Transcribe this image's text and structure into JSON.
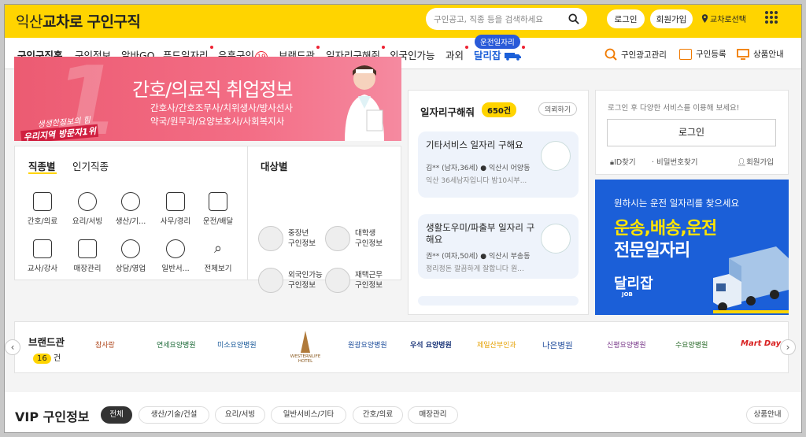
{
  "header": {
    "logo_light": "익산",
    "logo_bold": "교차로",
    "logo_suffix": "구인구직",
    "search_placeholder": "구인공고, 직종 등을 검색하세요",
    "login_label": "로그인",
    "signup_label": "회원가입",
    "region_label": "교차로선택"
  },
  "nav": {
    "items": [
      "구인구직홈",
      "구인정보",
      "알바GO",
      "푸드일자리",
      "유흥구인",
      "브랜드관",
      "일자리구해줘",
      "외국인가능",
      "과외",
      "달리잡"
    ],
    "adult_badge": "19",
    "new_bubble": "운전일자리",
    "right": [
      "구인광고관리",
      "구인등록",
      "상품안내"
    ]
  },
  "banner": {
    "title": "간호/의료직 취업정보",
    "line1": "간호사/간호조무사/치위생사/방사선사",
    "line2": "약국/원무과/요양보호사/사회복지사",
    "tag_top": "생생한정보의 힘",
    "tag_bottom": "우리지역 방문자1위"
  },
  "categories": {
    "tab_job": "직종별",
    "tab_popular": "인기직종",
    "items": [
      "간호/의료",
      "요리/서빙",
      "생산/기...",
      "사무/경리",
      "운전/배달",
      "교사/강사",
      "매장관리",
      "상담/영업",
      "일반서...",
      "전체보기"
    ],
    "target_title": "대상별",
    "targets": [
      {
        "l1": "중장년",
        "l2": "구인정보"
      },
      {
        "l1": "대학생",
        "l2": "구인정보"
      },
      {
        "l1": "외국인가능",
        "l2": "구인정보"
      },
      {
        "l1": "재택근무",
        "l2": "구인정보"
      }
    ]
  },
  "jobwant": {
    "title": "일자리구해줘",
    "count": "650건",
    "request_label": "의뢰하기",
    "posts": [
      {
        "title": "기타서비스 일자리 구해요",
        "name": "김** (남자,36세)",
        "location": "익산시 어양동",
        "desc": "익산 36세남자입니다 밤10시부..."
      },
      {
        "title": "생활도우미/파출부 일자리 구해요",
        "name": "권** (여자,50세)",
        "location": "익산시 부송동",
        "desc": "정리정돈 깔끔하게 잘합니다 원..."
      }
    ]
  },
  "login_box": {
    "prompt": "로그인 후 다양한 서비스를 이용해 보세요!",
    "button": "로그인",
    "find_id": "ID찾기",
    "find_pw": "비밀번호찾기",
    "join": "회원가입"
  },
  "promo": {
    "line1": "원하시는 운전 일자리를 찾으세요",
    "line2": "운송,배송,운전",
    "line3": "전문일자리",
    "brand": "달리잡",
    "brand_sub": "JOB"
  },
  "brands": {
    "title": "브랜드관",
    "count": "16",
    "count_unit": "건",
    "logos": [
      "참사랑",
      "연세요양병원",
      "미소요양병원",
      "WESTERNLIFE HOTEL",
      "원광요양병원",
      "우석 요양병원",
      "제일산부인과",
      "나은병원",
      "신평요양병원",
      "수요양병원",
      "Mart Day"
    ]
  },
  "vip": {
    "title": "VIP 구인정보",
    "chips": [
      "전체",
      "생산/기술/건설",
      "요리/서빙",
      "일반서비스/기타",
      "간호/의료",
      "매장관리"
    ],
    "guide": "상품안내"
  },
  "colors": {
    "brand_yellow": "#ffd400",
    "accent_blue": "#1b5fd8",
    "banner_pink": "#ec5b72"
  }
}
